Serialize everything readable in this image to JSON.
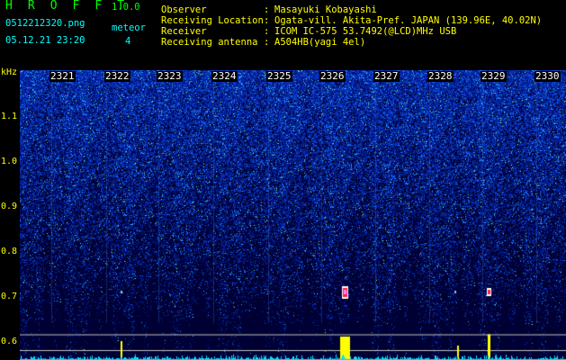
{
  "header": {
    "app_title": "H R O F F T",
    "version": "1.0.0",
    "filename": "0512212320.png",
    "datetime": "05.12.21 23:20",
    "meteor_label": "meteor",
    "meteor_count": "4"
  },
  "info": [
    {
      "label": "Observer",
      "value": "Masayuki Kobayashi"
    },
    {
      "label": "Receiving Location",
      "value": "Ogata-vill. Akita-Pref. JAPAN (139.96E, 40.02N)"
    },
    {
      "label": "Receiver",
      "value": "ICOM IC-575 53.7492(@LCD)MHz USB"
    },
    {
      "label": "Receiving antenna",
      "value": "A504HB(yagi 4el)"
    }
  ],
  "colon": ":",
  "spectrogram": {
    "unit": "kHz",
    "x_ticks": [
      "2321",
      "2322",
      "2323",
      "2324",
      "2325",
      "2326",
      "2327",
      "2328",
      "2329",
      "2330"
    ],
    "y_ticks": [
      "1.1",
      "1.0",
      "0.9",
      "0.8",
      "0.7",
      "0.6"
    ],
    "y_values": [
      1.1,
      1.0,
      0.9,
      0.8,
      0.7,
      0.6
    ],
    "meteor_echoes": [
      {
        "time": "2326",
        "freq_khz": 0.71,
        "strength": "strong"
      },
      {
        "time": "2329",
        "freq_khz": 0.71,
        "strength": "medium"
      },
      {
        "time": "2322",
        "freq_khz": 0.71,
        "strength": "weak"
      },
      {
        "time": "2328",
        "freq_khz": 0.71,
        "strength": "weak"
      }
    ],
    "colors": {
      "background": "#00003a",
      "noise_dark": "#001070",
      "noise_bright": "#3aa0ff",
      "echo_core": "#ff2040",
      "signal_bar": "#ffff00",
      "baseline": "#00e0ff"
    }
  }
}
